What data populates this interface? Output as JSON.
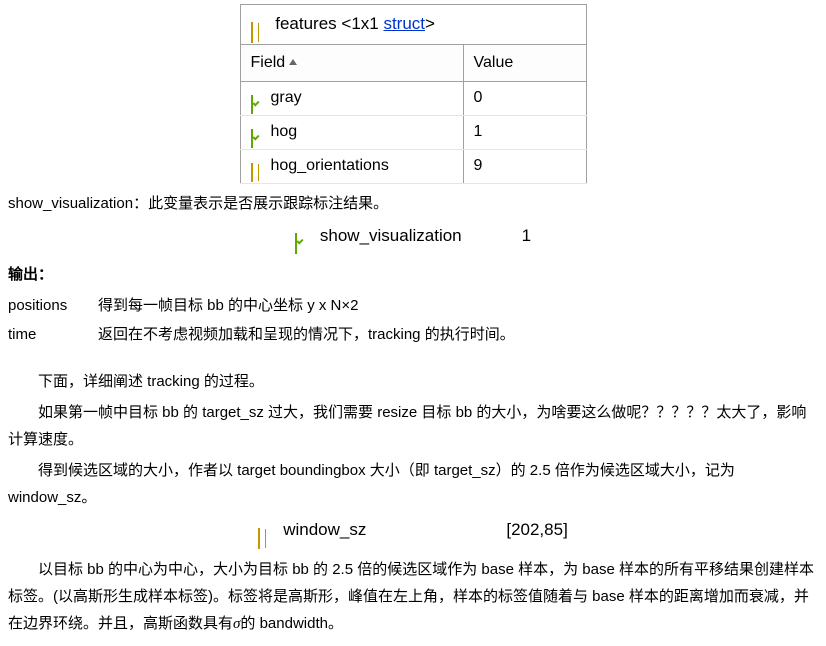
{
  "features_table": {
    "title_pre": "features ",
    "title_size": "<1x1 ",
    "title_link": "struct",
    "title_post": ">",
    "col_field": "Field",
    "col_value": "Value",
    "rows": [
      {
        "name": "gray",
        "value": "0",
        "icon": "logical"
      },
      {
        "name": "hog",
        "value": "1",
        "icon": "logical"
      },
      {
        "name": "hog_orientations",
        "value": "9",
        "icon": "struct"
      }
    ]
  },
  "line_showviz": "show_visualization：此变量表示是否展示跟踪标注结果。",
  "showviz_var": {
    "name": "show_visualization",
    "value": "1"
  },
  "outputs_title": "输出：",
  "outputs": [
    {
      "label": "positions",
      "desc": "得到每一帧目标 bb 的中心坐标  y x        N×2"
    },
    {
      "label": "time",
      "desc": "返回在不考虑视频加载和呈现的情况下，tracking 的执行时间。"
    }
  ],
  "para1": "下面，详细阐述 tracking 的过程。",
  "para2": "如果第一帧中目标 bb 的 target_sz 过大，我们需要 resize  目标 bb 的大小，为啥要这么做呢？？？？？太大了，影响计算速度。",
  "para3": "得到候选区域的大小，作者以 target boundingbox 大小（即 target_sz）的 2.5 倍作为候选区域大小，记为 window_sz。",
  "windowsz_var": {
    "name": "window_sz",
    "value": "[202,85]"
  },
  "para4_a": "以目标 bb 的中心为中心，大小为目标 bb 的 2.5 倍的候选区域作为 base 样本，为 base 样本的所有平移结果创建样本标签。(以高斯形生成样本标签)。标签将是高斯形，峰值在左上角，样本的标签值随着与 base 样本的距离增加而衰减，并在边界环绕。并且，高斯函数具有",
  "para4_sigma": "σ",
  "para4_b": "的 bandwidth。"
}
